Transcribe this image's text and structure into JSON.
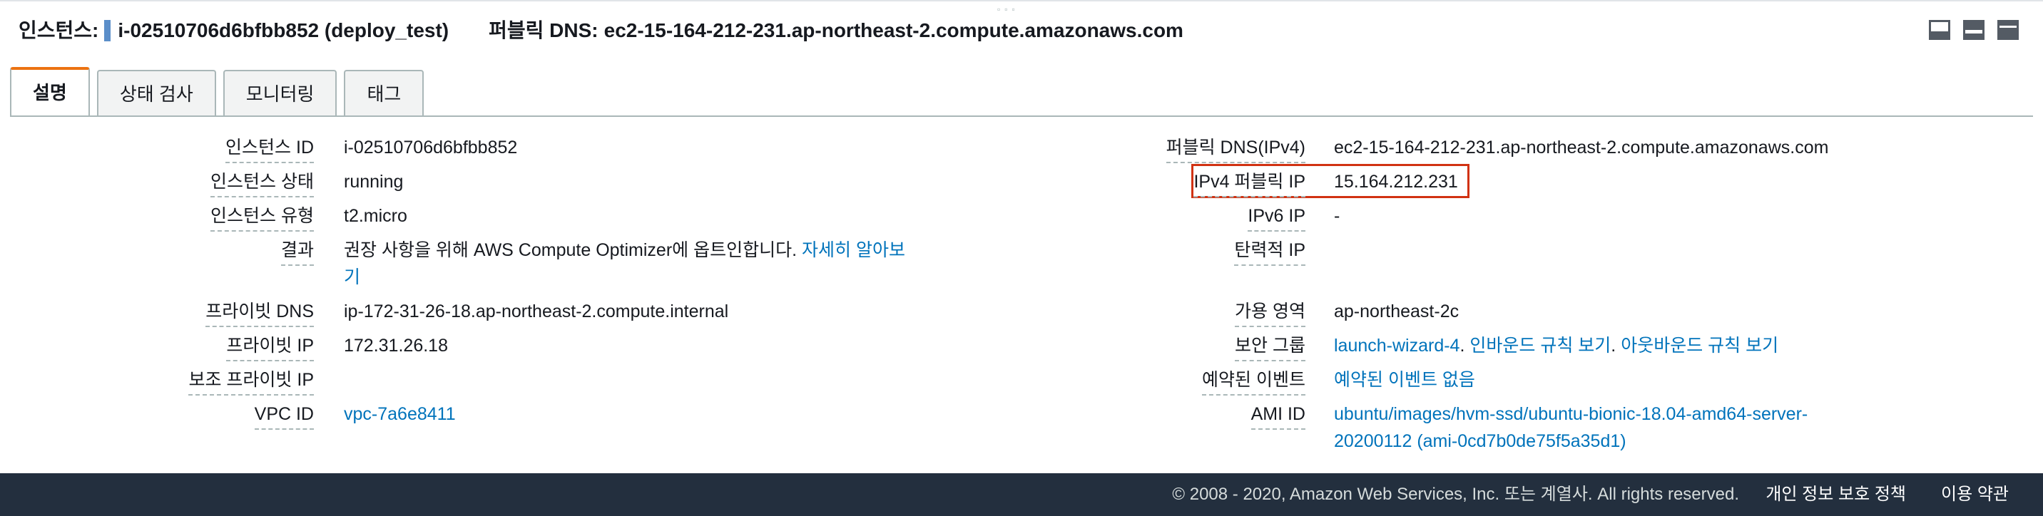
{
  "header": {
    "instance_label": "인스턴스:",
    "instance_value": "i-02510706d6bfbb852 (deploy_test)",
    "dns_label": "퍼블릭 DNS:",
    "dns_value": "ec2-15-164-212-231.ap-northeast-2.compute.amazonaws.com"
  },
  "tabs": [
    {
      "label": "설명",
      "active": true
    },
    {
      "label": "상태 검사",
      "active": false
    },
    {
      "label": "모니터링",
      "active": false
    },
    {
      "label": "태그",
      "active": false
    }
  ],
  "left": {
    "instance_id": {
      "label": "인스턴스 ID",
      "value": "i-02510706d6bfbb852"
    },
    "instance_state": {
      "label": "인스턴스 상태",
      "value": "running"
    },
    "instance_type": {
      "label": "인스턴스 유형",
      "value": "t2.micro"
    },
    "finding": {
      "label": "결과",
      "text": "권장 사항을 위해 AWS Compute Optimizer에 옵트인합니다.",
      "link_1": "자세히 알아보",
      "link_2": "기"
    },
    "private_dns": {
      "label": "프라이빗 DNS",
      "value": "ip-172-31-26-18.ap-northeast-2.compute.internal"
    },
    "private_ip": {
      "label": "프라이빗 IP",
      "value": "172.31.26.18"
    },
    "secondary_private_ip": {
      "label": "보조 프라이빗 IP",
      "value": ""
    },
    "vpc_id": {
      "label": "VPC ID",
      "value": "vpc-7a6e8411"
    }
  },
  "right": {
    "public_dns": {
      "label": "퍼블릭 DNS(IPv4)",
      "value": "ec2-15-164-212-231.ap-northeast-2.compute.amazonaws.com"
    },
    "ipv4_public_ip": {
      "label": "IPv4 퍼블릭 IP",
      "value": "15.164.212.231"
    },
    "ipv6_ip": {
      "label": "IPv6 IP",
      "value": "-"
    },
    "elastic_ip": {
      "label": "탄력적 IP",
      "value": ""
    },
    "availability_zone": {
      "label": "가용 영역",
      "value": "ap-northeast-2c"
    },
    "security_groups": {
      "label": "보안 그룹",
      "group": "launch-wizard-4",
      "sep1": ". ",
      "inbound": "인바운드 규칙 보기",
      "sep2": ". ",
      "outbound": "아웃바운드 규칙 보기"
    },
    "scheduled_events": {
      "label": "예약된 이벤트",
      "value": "예약된 이벤트 없음"
    },
    "ami_id": {
      "label": "AMI ID",
      "line_1": "ubuntu/images/hvm-ssd/ubuntu-bionic-18.04-amd64-server-",
      "line_2": "20200112 (ami-0cd7b0de75f5a35d1)"
    }
  },
  "footer": {
    "copyright": "© 2008 - 2020, Amazon Web Services, Inc. 또는 계열사. All rights reserved.",
    "privacy": "개인 정보 보호 정책",
    "terms": "이용 약관"
  },
  "colors": {
    "link": "#0073bb",
    "highlight_box": "#d13212",
    "footer_bg": "#232f3e",
    "tab_accent": "#ec7211"
  },
  "icons": [
    "layout-bottom-icon",
    "layout-split-icon",
    "layout-top-icon"
  ]
}
